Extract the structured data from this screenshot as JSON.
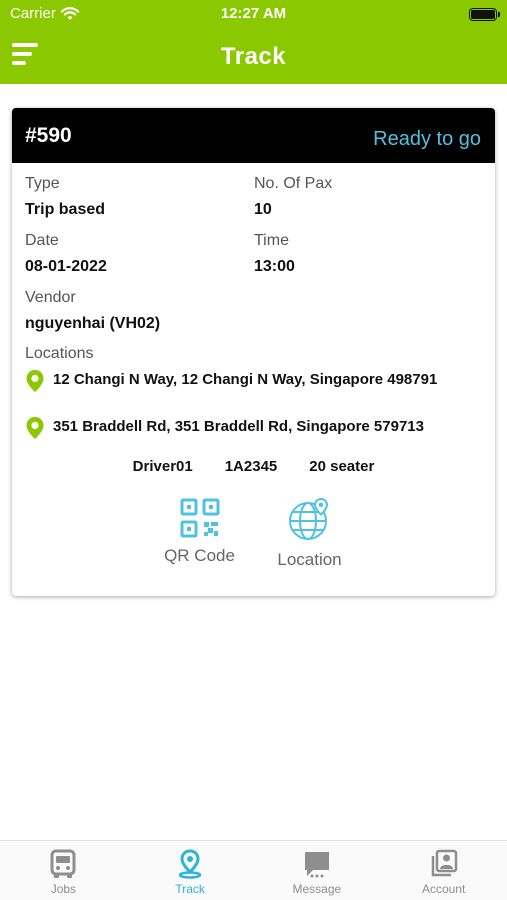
{
  "status_bar": {
    "carrier": "Carrier",
    "time": "12:27 AM"
  },
  "nav": {
    "title": "Track",
    "menu_icon": "hamburger-menu-icon"
  },
  "colors": {
    "primary": "#8cc800",
    "accent": "#4ec3e0",
    "header_bg": "#000000"
  },
  "job": {
    "id": "#590",
    "status": "Ready to go",
    "type_label": "Type",
    "type_value": "Trip based",
    "pax_label": "No. Of Pax",
    "pax_value": "10",
    "date_label": "Date",
    "date_value": "08-01-2022",
    "time_label": "Time",
    "time_value": "13:00",
    "vendor_label": "Vendor",
    "vendor_value": "nguyenhai (VH02)",
    "locations_label": "Locations",
    "locations": [
      "12 Changi N Way, 12 Changi N Way, Singapore 498791",
      "351 Braddell Rd, 351 Braddell Rd, Singapore 579713"
    ],
    "driver": "Driver01",
    "plate": "1A2345",
    "seater": "20 seater",
    "actions": [
      {
        "label": "QR Code",
        "icon": "qr-code-icon"
      },
      {
        "label": "Location",
        "icon": "globe-location-icon"
      }
    ]
  },
  "tabs": [
    {
      "label": "Jobs",
      "icon": "bus-icon",
      "active": false
    },
    {
      "label": "Track",
      "icon": "track-pin-icon",
      "active": true
    },
    {
      "label": "Message",
      "icon": "message-icon",
      "active": false
    },
    {
      "label": "Account",
      "icon": "account-icon",
      "active": false
    }
  ]
}
